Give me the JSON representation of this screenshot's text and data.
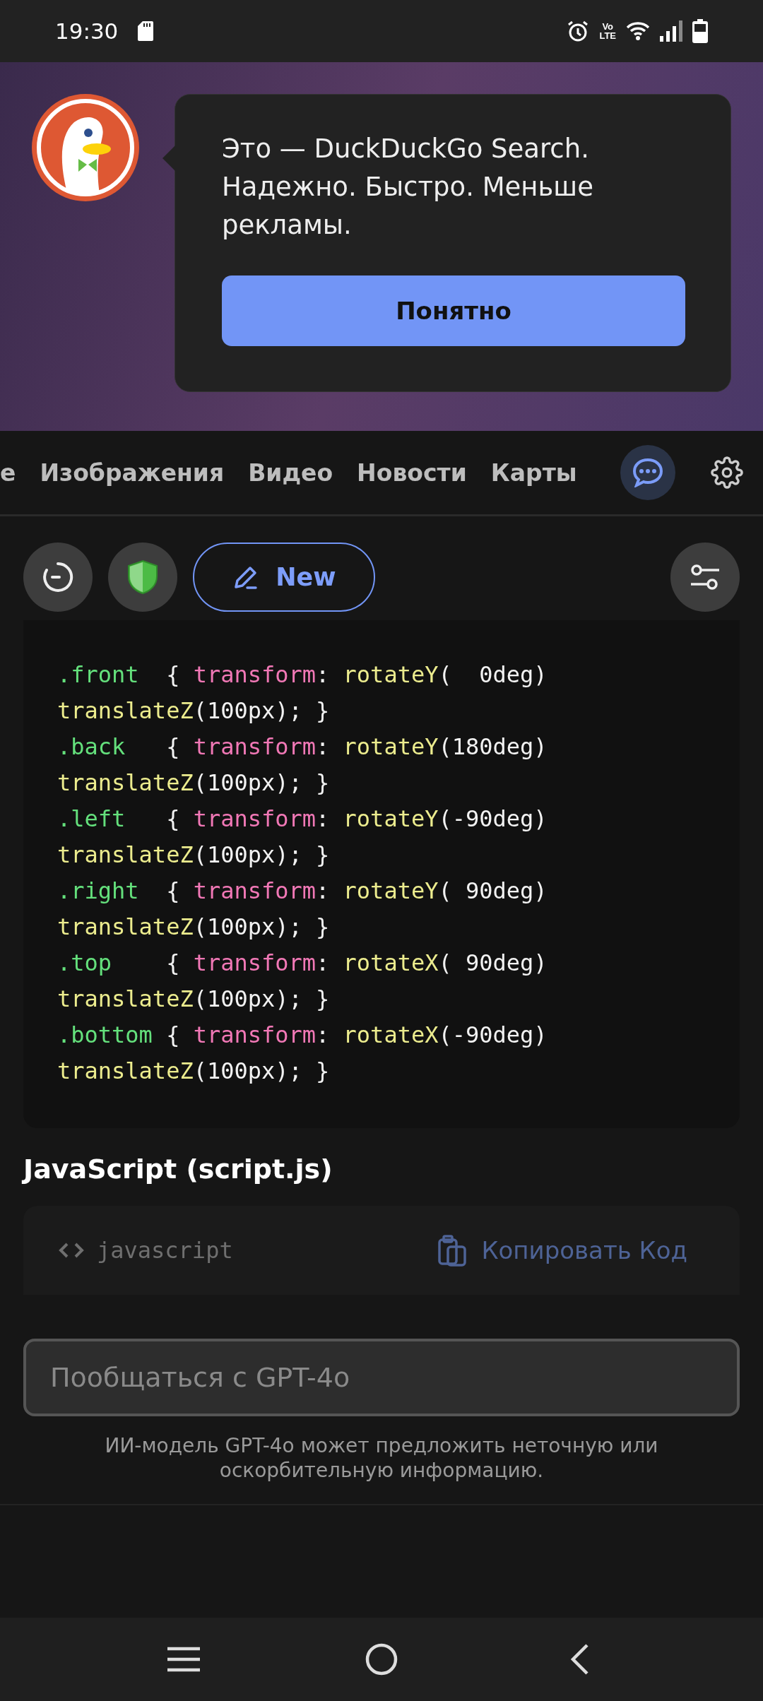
{
  "status_bar": {
    "time": "19:30",
    "volte": [
      "Vo",
      "LTE"
    ]
  },
  "onboarding": {
    "message": "Это — DuckDuckGo Search. Надежно. Быстро. Меньше рекламы.",
    "button": "Понятно"
  },
  "tabs": [
    {
      "label": "е",
      "selected": false
    },
    {
      "label": "Изображения",
      "selected": false
    },
    {
      "label": "Видео",
      "selected": false
    },
    {
      "label": "Новости",
      "selected": false
    },
    {
      "label": "Карты",
      "selected": false
    }
  ],
  "chat_button": {
    "selected": true
  },
  "toolbar": {
    "new_button": "New"
  },
  "code_block": {
    "lines": [
      [
        {
          "kind": "selector",
          "text": ".front"
        },
        {
          "kind": "plain",
          "text": "  { "
        },
        {
          "kind": "property",
          "text": "transform"
        },
        {
          "kind": "plain",
          "text": ": "
        },
        {
          "kind": "function",
          "text": "rotateY"
        },
        {
          "kind": "plain",
          "text": "(  0deg)"
        }
      ],
      [
        {
          "kind": "function",
          "text": "translateZ"
        },
        {
          "kind": "plain",
          "text": "(100px); }"
        }
      ],
      [
        {
          "kind": "selector",
          "text": ".back"
        },
        {
          "kind": "plain",
          "text": "   { "
        },
        {
          "kind": "property",
          "text": "transform"
        },
        {
          "kind": "plain",
          "text": ": "
        },
        {
          "kind": "function",
          "text": "rotateY"
        },
        {
          "kind": "plain",
          "text": "(180deg)"
        }
      ],
      [
        {
          "kind": "function",
          "text": "translateZ"
        },
        {
          "kind": "plain",
          "text": "(100px); }"
        }
      ],
      [
        {
          "kind": "selector",
          "text": ".left"
        },
        {
          "kind": "plain",
          "text": "   { "
        },
        {
          "kind": "property",
          "text": "transform"
        },
        {
          "kind": "plain",
          "text": ": "
        },
        {
          "kind": "function",
          "text": "rotateY"
        },
        {
          "kind": "plain",
          "text": "(-90deg)"
        }
      ],
      [
        {
          "kind": "function",
          "text": "translateZ"
        },
        {
          "kind": "plain",
          "text": "(100px); }"
        }
      ],
      [
        {
          "kind": "selector",
          "text": ".right"
        },
        {
          "kind": "plain",
          "text": "  { "
        },
        {
          "kind": "property",
          "text": "transform"
        },
        {
          "kind": "plain",
          "text": ": "
        },
        {
          "kind": "function",
          "text": "rotateY"
        },
        {
          "kind": "plain",
          "text": "( 90deg)"
        }
      ],
      [
        {
          "kind": "function",
          "text": "translateZ"
        },
        {
          "kind": "plain",
          "text": "(100px); }"
        }
      ],
      [
        {
          "kind": "selector",
          "text": ".top"
        },
        {
          "kind": "plain",
          "text": "    { "
        },
        {
          "kind": "property",
          "text": "transform"
        },
        {
          "kind": "plain",
          "text": ": "
        },
        {
          "kind": "function",
          "text": "rotateX"
        },
        {
          "kind": "plain",
          "text": "( 90deg)"
        }
      ],
      [
        {
          "kind": "function",
          "text": "translateZ"
        },
        {
          "kind": "plain",
          "text": "(100px); }"
        }
      ],
      [
        {
          "kind": "selector",
          "text": ".bottom"
        },
        {
          "kind": "plain",
          "text": " { "
        },
        {
          "kind": "property",
          "text": "transform"
        },
        {
          "kind": "plain",
          "text": ": "
        },
        {
          "kind": "function",
          "text": "rotateX"
        },
        {
          "kind": "plain",
          "text": "(-90deg)"
        }
      ],
      [
        {
          "kind": "function",
          "text": "translateZ"
        },
        {
          "kind": "plain",
          "text": "(100px); }"
        }
      ]
    ]
  },
  "section_title": "JavaScript (script.js)",
  "code_header": {
    "language": "javascript",
    "copy": "Копировать Код"
  },
  "chat_input": {
    "placeholder": "Пообщаться с GPT-4o"
  },
  "disclaimer": "ИИ-модель GPT-4o может предложить неточную или оскорбительную информацию."
}
